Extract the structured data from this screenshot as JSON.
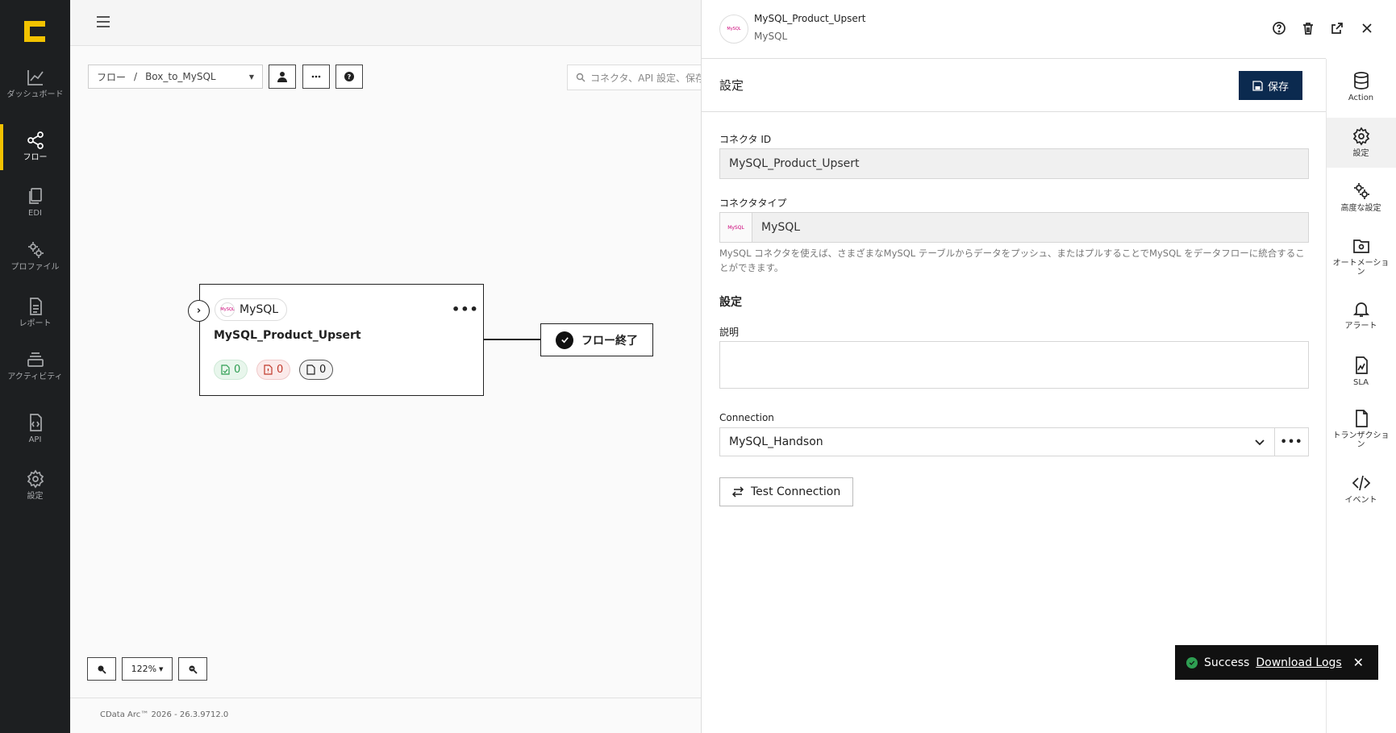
{
  "nav": {
    "items": [
      {
        "label": "ダッシュボード",
        "icon": "chart-line-icon"
      },
      {
        "label": "フロー",
        "icon": "share-nodes-icon",
        "active": true
      },
      {
        "label": "EDI",
        "icon": "documents-icon"
      },
      {
        "label": "プロファイル",
        "icon": "gears-icon"
      },
      {
        "label": "レポート",
        "icon": "report-icon"
      },
      {
        "label": "アクティビティ",
        "icon": "stack-icon"
      },
      {
        "label": "API",
        "icon": "api-file-icon"
      },
      {
        "label": "設定",
        "icon": "gear-icon"
      }
    ]
  },
  "toolbar": {
    "breadcrumb_root": "フロー",
    "breadcrumb_sep": "/",
    "breadcrumb_current": "Box_to_MySQL",
    "search_placeholder": "コネクタ、API 設定、保存"
  },
  "canvas": {
    "node": {
      "type_label": "MySQL",
      "logo_text": "MySQL",
      "name": "MySQL_Product_Upsert",
      "success_count": "0",
      "error_count": "0",
      "pending_count": "0"
    },
    "end_node_label": "フロー終了",
    "zoom_level": "122%",
    "footer_text": "CData Arc™ 2026 - 26.3.9712.0"
  },
  "panel": {
    "title": "MySQL_Product_Upsert",
    "subtitle": "MySQL",
    "logo_text": "MySQL",
    "section_title": "設定",
    "save_label": "保存",
    "connector_id_label": "コネクタ ID",
    "connector_id_value": "MySQL_Product_Upsert",
    "connector_type_label": "コネクタタイプ",
    "connector_type_value": "MySQL",
    "help_text": "MySQL コネクタを使えば、さまざまなMySQL テーブルからデータをプッシュ、またはプルすることでMySQL をデータフローに統合することができます。",
    "settings_subtitle": "設定",
    "description_label": "説明",
    "description_value": "",
    "connection_label": "Connection",
    "connection_value": "MySQL_Handson",
    "test_connection_label": "Test Connection"
  },
  "rail": {
    "items": [
      {
        "label": "Action",
        "icon": "database-icon"
      },
      {
        "label": "設定",
        "icon": "gear-icon",
        "active": true
      },
      {
        "label": "高度な設定",
        "icon": "gears-icon"
      },
      {
        "label": "オートメーション",
        "icon": "folder-gear-icon"
      },
      {
        "label": "アラート",
        "icon": "bell-icon"
      },
      {
        "label": "SLA",
        "icon": "sla-file-icon"
      },
      {
        "label": "トランザクション",
        "icon": "file-icon"
      },
      {
        "label": "イベント",
        "icon": "code-icon"
      }
    ]
  },
  "toast": {
    "status": "Success",
    "link": "Download Logs"
  },
  "colors": {
    "sidebar_bg": "#1d1f21",
    "accent_yellow": "#f2c200",
    "save_button_bg": "#0b2a4f",
    "success_green": "#2e9e52",
    "error_red": "#c0392b"
  }
}
